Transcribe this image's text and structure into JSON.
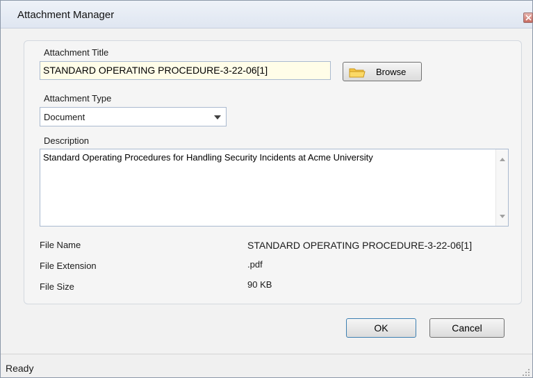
{
  "window": {
    "title": "Attachment Manager"
  },
  "form": {
    "attachment_title_label": "Attachment Title",
    "attachment_title_value": "STANDARD OPERATING PROCEDURE-3-22-06[1]",
    "browse_label": "Browse",
    "attachment_type_label": "Attachment Type",
    "attachment_type_value": "Document",
    "description_label": "Description",
    "description_value": "Standard Operating Procedures for Handling Security Incidents at Acme University"
  },
  "file_info": {
    "file_name_label": "File Name",
    "file_name_value": "STANDARD OPERATING PROCEDURE-3-22-06[1]",
    "file_extension_label": "File Extension",
    "file_extension_value": ".pdf",
    "file_size_label": "File Size",
    "file_size_value": "90 KB"
  },
  "buttons": {
    "ok_label": "OK",
    "cancel_label": "Cancel"
  },
  "status": {
    "text": "Ready"
  },
  "icons": {
    "close": "close-icon",
    "folder": "folder-icon",
    "dropdown": "chevron-down-icon",
    "scroll_up": "scroll-up-icon",
    "scroll_down": "scroll-down-icon",
    "grip": "resize-grip-icon"
  },
  "colors": {
    "title_bar": "#dfe6f1",
    "input_highlight": "#fffde8",
    "default_button_border": "#3c7fb1"
  }
}
